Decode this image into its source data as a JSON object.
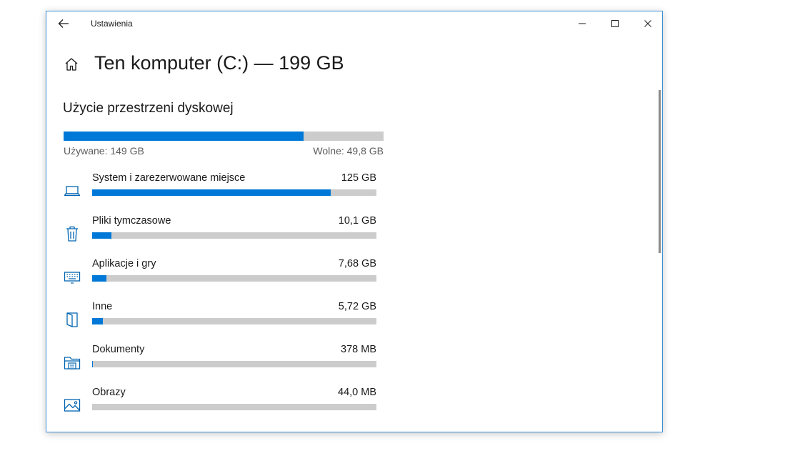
{
  "window": {
    "app_title": "Ustawienia"
  },
  "header": {
    "title": "Ten komputer (C:) — 199 GB"
  },
  "storage": {
    "section_title": "Użycie przestrzeni dyskowej",
    "used_label": "Używane: 149 GB",
    "free_label": "Wolne: 49,8 GB",
    "used_fraction": 0.75
  },
  "categories": [
    {
      "name": "System i zarezerwowane miejsce",
      "size": "125 GB",
      "icon": "laptop-icon",
      "fraction": 0.84
    },
    {
      "name": "Pliki tymczasowe",
      "size": "10,1 GB",
      "icon": "trash-icon",
      "fraction": 0.068
    },
    {
      "name": "Aplikacje i gry",
      "size": "7,68 GB",
      "icon": "keyboard-icon",
      "fraction": 0.05
    },
    {
      "name": "Inne",
      "size": "5,72 GB",
      "icon": "folder-page-icon",
      "fraction": 0.038
    },
    {
      "name": "Dokumenty",
      "size": "378 MB",
      "icon": "documents-folder-icon",
      "fraction": 0.003
    },
    {
      "name": "Obrazy",
      "size": "44,0 MB",
      "icon": "picture-icon",
      "fraction": 0.0
    }
  ],
  "colors": {
    "accent": "#0078d7",
    "track": "#cccccc",
    "window_border": "#3d8fd6"
  }
}
